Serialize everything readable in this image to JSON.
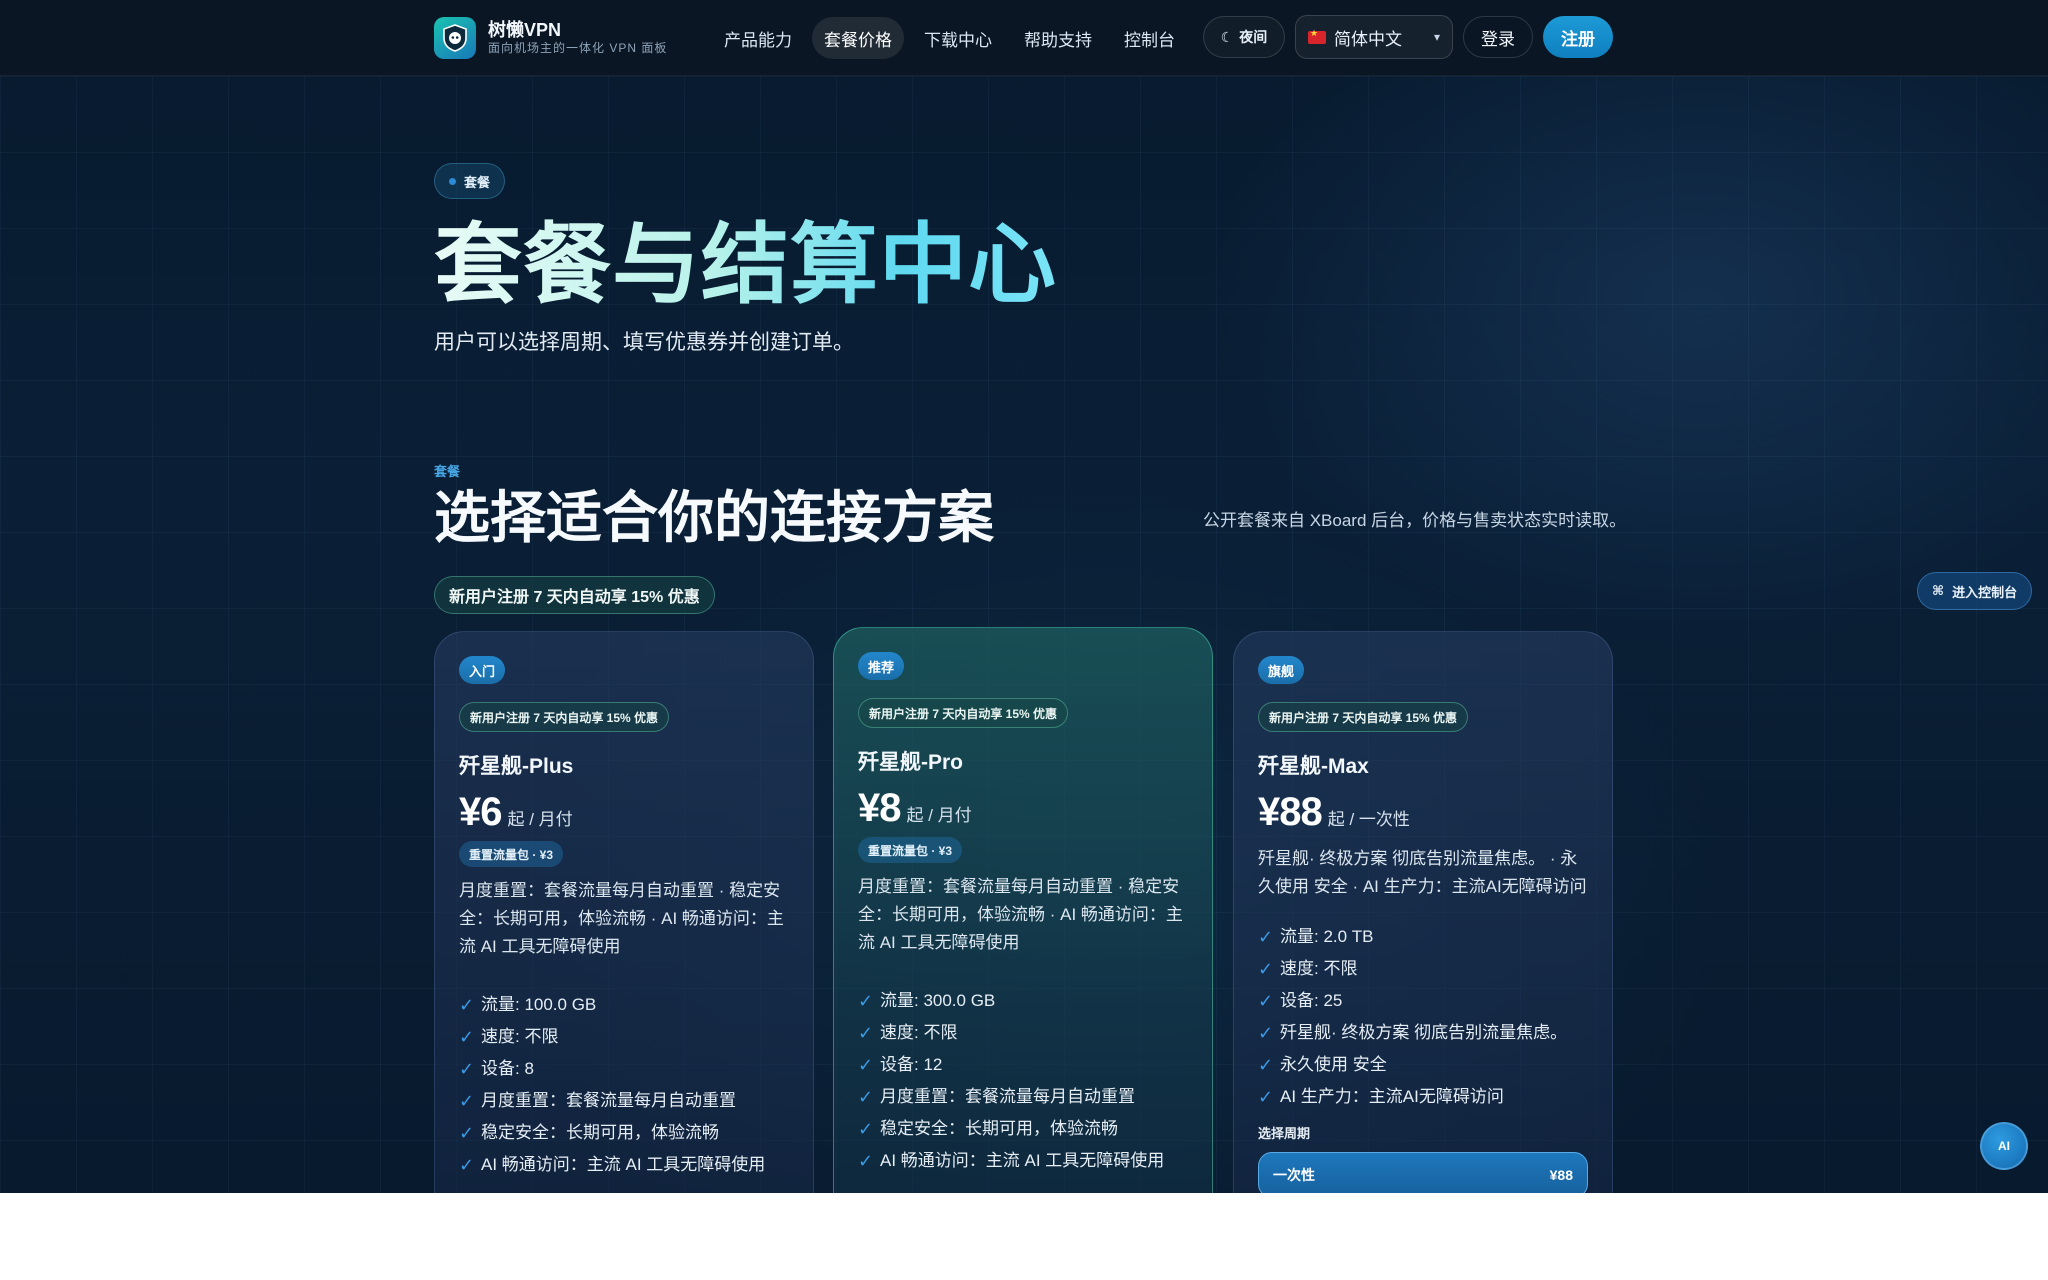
{
  "brand": {
    "name": "树懒VPN",
    "subtitle": "面向机场主的一体化 VPN 面板"
  },
  "nav": [
    "产品能力",
    "套餐价格",
    "下载中心",
    "帮助支持",
    "控制台"
  ],
  "header": {
    "theme_icon": "☾",
    "theme_label": "夜间",
    "language": "简体中文",
    "login": "登录",
    "register": "注册"
  },
  "hero": {
    "badge": "套餐",
    "title": "套餐与结算中心",
    "subtitle": "用户可以选择周期、填写优惠券并创建订单。"
  },
  "section": {
    "kicker": "套餐",
    "title": "选择适合你的连接方案",
    "note": "公开套餐来自 XBoard 后台，价格与售卖状态实时读取。",
    "promo": "新用户注册 7 天内自动享 15% 优惠"
  },
  "plans": [
    {
      "tier": "入门",
      "promo": "新用户注册 7 天内自动享 15% 优惠",
      "name": "歼星舰-Plus",
      "price": "¥6",
      "unit": "起 / 月付",
      "reset": "重置流量包 · ¥3",
      "desc": "月度重置：套餐流量每月自动重置 · 稳定安全：长期可用，体验流畅 · AI 畅通访问：主流 AI 工具无障碍使用",
      "features": [
        "流量: 100.0 GB",
        "速度: 不限",
        "设备: 8",
        "月度重置：套餐流量每月自动重置",
        "稳定安全：长期可用，体验流畅",
        "AI 畅通访问：主流 AI 工具无障碍使用"
      ]
    },
    {
      "tier": "推荐",
      "promo": "新用户注册 7 天内自动享 15% 优惠",
      "name": "歼星舰-Pro",
      "price": "¥8",
      "unit": "起 / 月付",
      "reset": "重置流量包 · ¥3",
      "desc": "月度重置：套餐流量每月自动重置 · 稳定安全：长期可用，体验流畅 · AI 畅通访问：主流 AI 工具无障碍使用",
      "features": [
        "流量: 300.0 GB",
        "速度: 不限",
        "设备: 12",
        "月度重置：套餐流量每月自动重置",
        "稳定安全：长期可用，体验流畅",
        "AI 畅通访问：主流 AI 工具无障碍使用"
      ]
    },
    {
      "tier": "旗舰",
      "promo": "新用户注册 7 天内自动享 15% 优惠",
      "name": "歼星舰-Max",
      "price": "¥88",
      "unit": "起 / 一次性",
      "desc": "歼星舰· 终极方案 彻底告别流量焦虑。 · 永久使用 安全 · AI 生产力：主流AI无障碍访问",
      "features": [
        "流量: 2.0 TB",
        "速度: 不限",
        "设备: 25",
        "歼星舰· 终极方案 彻底告别流量焦虑。",
        "永久使用 安全",
        "AI 生产力：主流AI无障碍访问"
      ],
      "period_label": "选择周期",
      "period": {
        "label": "一次性",
        "price": "¥88"
      }
    }
  ],
  "floating": {
    "console": "进入控制台",
    "ai": "AI"
  },
  "colors": {
    "accent": "#1d9bd6",
    "page_bg": "#071a2e",
    "featured_border": "#46c8aa"
  }
}
